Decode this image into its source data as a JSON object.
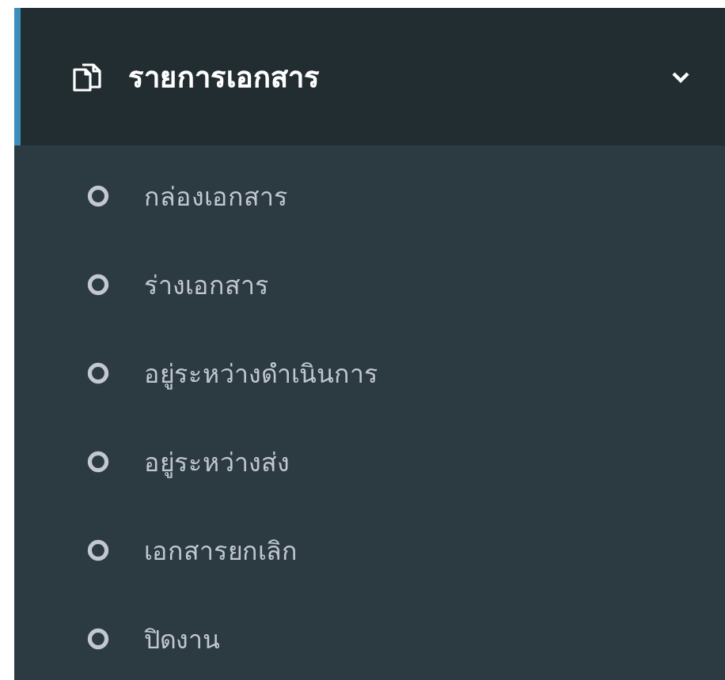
{
  "menu": {
    "title": "รายการเอกสาร",
    "expanded": true,
    "items": [
      {
        "label": "กล่องเอกสาร"
      },
      {
        "label": "ร่างเอกสาร"
      },
      {
        "label": "อยู่ระหว่างดำเนินการ"
      },
      {
        "label": "อยู่ระหว่างส่ง"
      },
      {
        "label": "เอกสารยกเลิก"
      },
      {
        "label": "ปิดงาน"
      }
    ]
  }
}
